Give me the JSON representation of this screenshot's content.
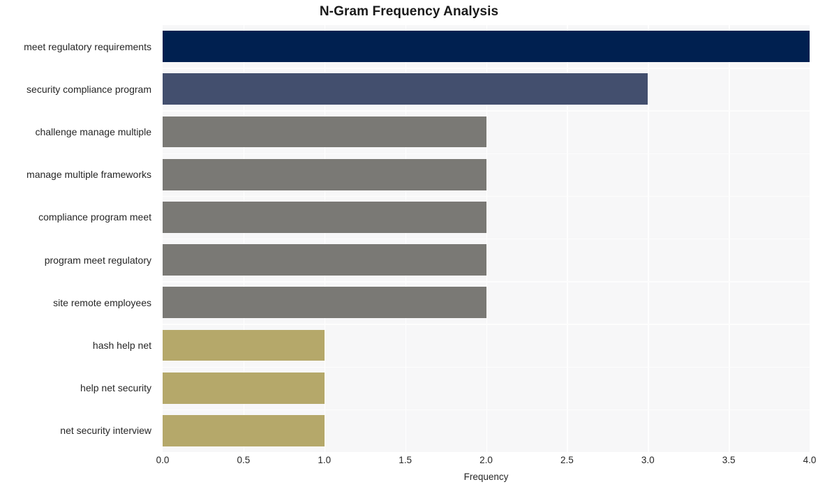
{
  "chart_data": {
    "type": "bar",
    "orientation": "horizontal",
    "title": "N-Gram Frequency Analysis",
    "xlabel": "Frequency",
    "ylabel": "",
    "xlim": [
      0.0,
      4.0
    ],
    "xticks": [
      "0.0",
      "0.5",
      "1.0",
      "1.5",
      "2.0",
      "2.5",
      "3.0",
      "3.5",
      "4.0"
    ],
    "xtick_values": [
      0.0,
      0.5,
      1.0,
      1.5,
      2.0,
      2.5,
      3.0,
      3.5,
      4.0
    ],
    "grid": true,
    "legend": "none",
    "categories": [
      "meet regulatory requirements",
      "security compliance program",
      "challenge manage multiple",
      "manage multiple frameworks",
      "compliance program meet",
      "program meet regulatory",
      "site remote employees",
      "hash help net",
      "help net security",
      "net security interview"
    ],
    "values": [
      4,
      3,
      2,
      2,
      2,
      2,
      2,
      1,
      1,
      1
    ],
    "bar_colors": [
      "#002050",
      "#434f6e",
      "#7a7975",
      "#7a7975",
      "#7a7975",
      "#7a7975",
      "#7a7975",
      "#b5a86a",
      "#b5a86a",
      "#b5a86a"
    ],
    "plot_background": "#f7f7f8",
    "grid_color": "#ffffff",
    "figure_background": "#ffffff",
    "text_color": "#262626"
  }
}
